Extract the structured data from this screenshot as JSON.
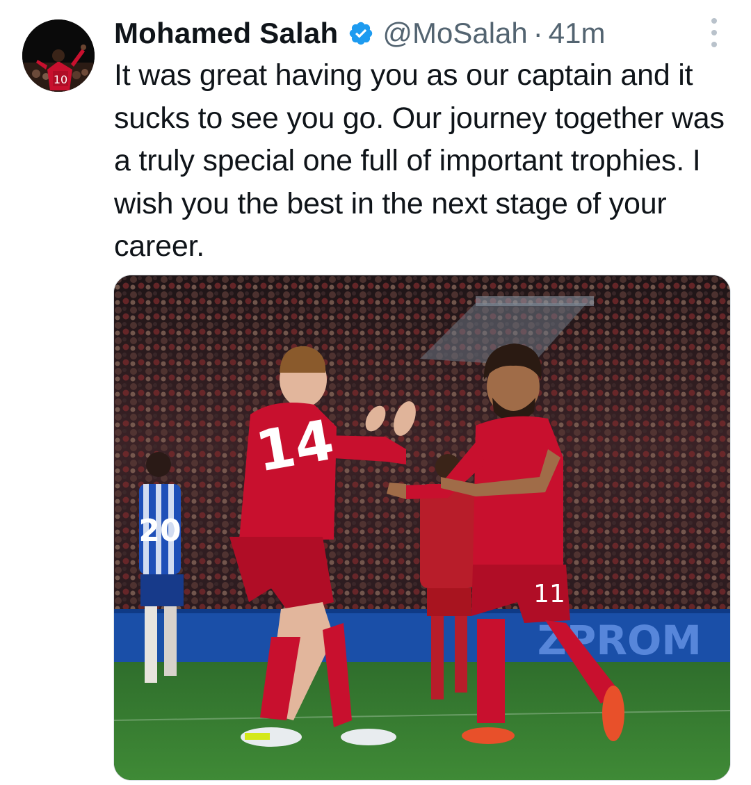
{
  "tweet": {
    "author_name": "Mohamed Salah",
    "handle": "@MoSalah",
    "separator": "·",
    "time": "41m",
    "text": "It was great having you as our captain and it sucks to see you go. Our journey together was a truly special one full of important trophies. I wish you the best in the next stage of your career.",
    "avatar_number": "10"
  },
  "media": {
    "player_left_number": "14",
    "player_right_number": "11",
    "opponent_number": "20",
    "board_text": "ZPROM",
    "description_icon": "photo"
  },
  "colors": {
    "verified": "#1d9bf0",
    "text_secondary": "#536471",
    "text_primary": "#0f1419",
    "kit_red": "#c8102e"
  },
  "icons": {
    "verified": "verified-badge-icon",
    "more": "more-options-icon"
  }
}
